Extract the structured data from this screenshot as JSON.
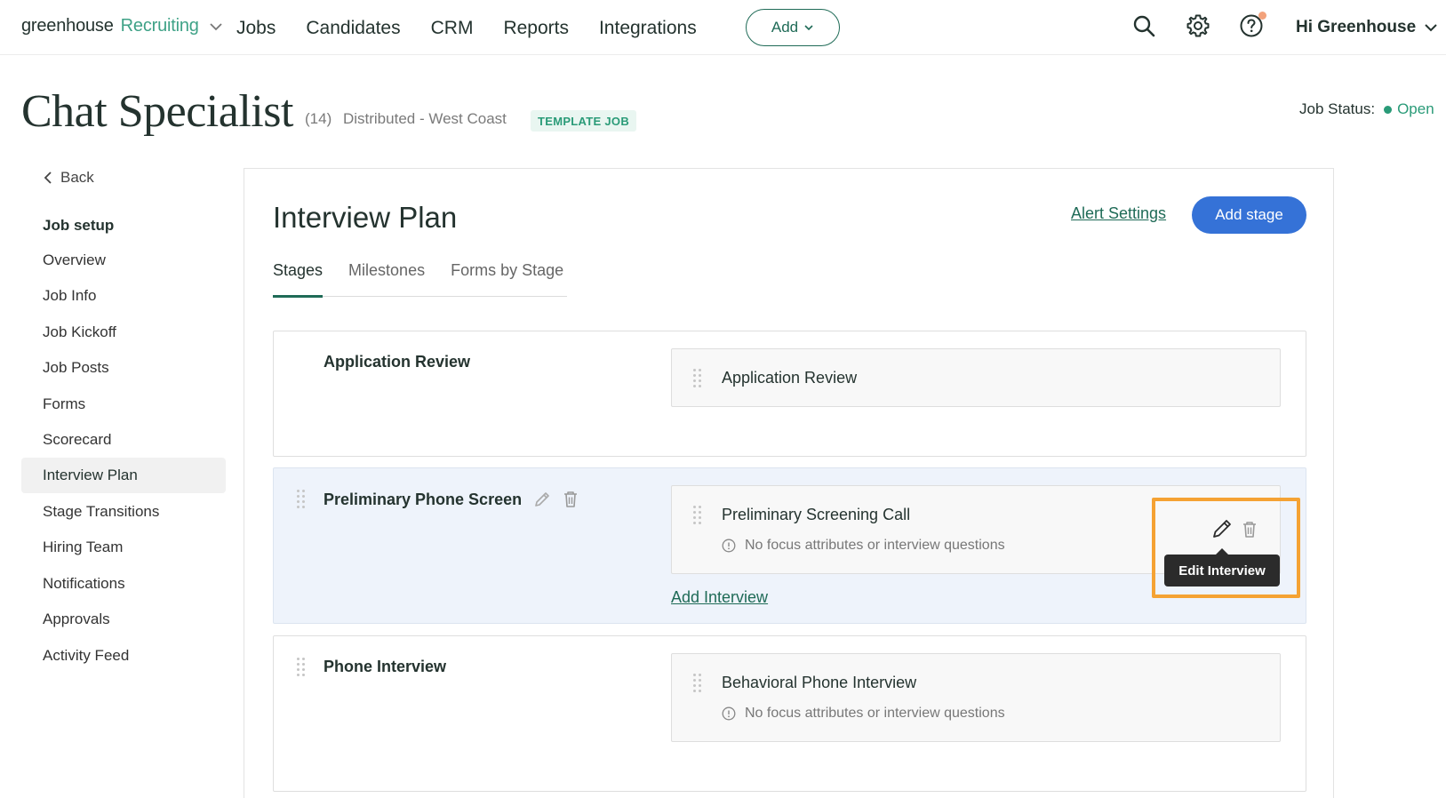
{
  "app": {
    "logo_text": "greenhouse",
    "logo_product": "Recruiting",
    "nav": [
      "Jobs",
      "Candidates",
      "CRM",
      "Reports",
      "Integrations"
    ],
    "add_label": "Add",
    "greeting": "Hi Greenhouse"
  },
  "job": {
    "title": "Chat Specialist",
    "count": "(14)",
    "location": "Distributed - West Coast",
    "badge": "TEMPLATE JOB",
    "status_label": "Job Status:",
    "status_value": "Open"
  },
  "sidebar": {
    "back": "Back",
    "heading": "Job setup",
    "items": [
      "Overview",
      "Job Info",
      "Job Kickoff",
      "Job Posts",
      "Forms",
      "Scorecard",
      "Interview Plan",
      "Stage Transitions",
      "Hiring Team",
      "Notifications",
      "Approvals",
      "Activity Feed"
    ],
    "active": "Interview Plan"
  },
  "main": {
    "title": "Interview Plan",
    "alert_settings": "Alert Settings",
    "add_stage": "Add stage",
    "tabs": [
      "Stages",
      "Milestones",
      "Forms by Stage"
    ],
    "stages": [
      {
        "name": "Application Review",
        "interviews": [
          {
            "name": "Application Review",
            "note": ""
          }
        ]
      },
      {
        "name": "Preliminary Phone Screen",
        "interviews": [
          {
            "name": "Preliminary Screening Call",
            "note": "No focus attributes or interview questions"
          }
        ],
        "add_interview": "Add Interview"
      },
      {
        "name": "Phone Interview",
        "interviews": [
          {
            "name": "Behavioral Phone Interview",
            "note": "No focus attributes or interview questions"
          }
        ]
      }
    ],
    "tooltip": "Edit Interview"
  },
  "colors": {
    "primary_green": "#1f6b57",
    "accent_green": "#2a9b78",
    "blue": "#3572d7",
    "highlight_orange": "#f5a233"
  }
}
